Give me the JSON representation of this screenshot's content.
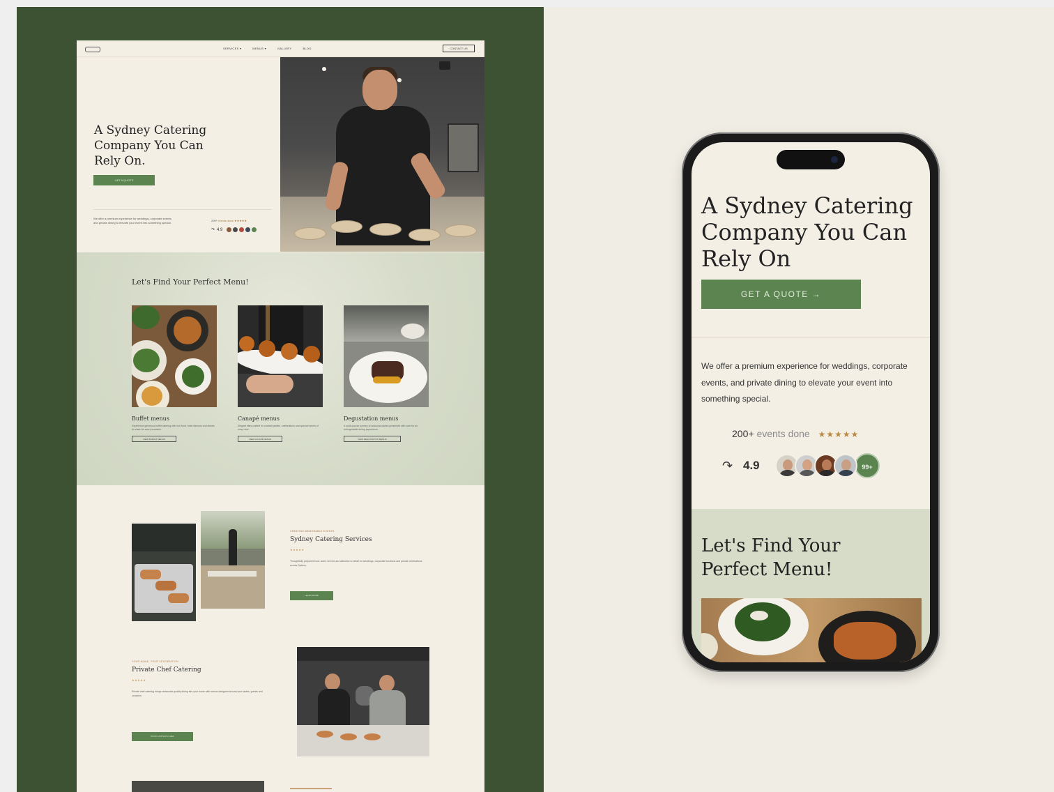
{
  "colors": {
    "brand_green": "#5b8451",
    "panel_green": "#3c5233",
    "cream": "#f3efe5",
    "sage": "#d7dcc9",
    "star_gold": "#b88a44"
  },
  "desktop": {
    "nav": {
      "links": [
        "SERVICES ▾",
        "MENUS ▾",
        "GALLERY",
        "BLOG"
      ],
      "cta": "CONTACT US"
    },
    "hero": {
      "title": "A Sydney Catering Company You Can Rely On.",
      "cta": "GET A QUOTE",
      "desc": "We offer a premium experience for weddings, corporate events, and private dining to elevate your event into something special.",
      "events": "200+",
      "events_label": "events done ★★★★★",
      "rating": "4.9"
    },
    "menus": {
      "title": "Let's Find Your Perfect Menu!",
      "cards": [
        {
          "name": "Buffet menus",
          "desc": "Experience generous buffet catering with rich food, fresh flavours and dishes to share for every occasion.",
          "btn": "VIEW BUFFET MENUS"
        },
        {
          "name": "Canapé menus",
          "desc": "Elegant bites crafted for cocktail parties, celebrations and special events of every size.",
          "btn": "VIEW CANAPÉ MENUS"
        },
        {
          "name": "Degustation menus",
          "desc": "A multi-course journey of seasonal dishes presented with care for an unforgettable dining experience.",
          "btn": "VIEW DEGUSTATION MENUS"
        }
      ]
    },
    "services": {
      "eyebrow": "CREATING MEMORABLE EVENTS",
      "title": "Sydney Catering Services",
      "stars": "★★★★★",
      "desc": "Thoughtfully prepared food, warm service and attention to detail for weddings, corporate functions and private celebrations across Sydney.",
      "btn": "LEARN MORE"
    },
    "private": {
      "eyebrow": "YOUR HOME, YOUR CELEBRATION",
      "title": "Private Chef Catering",
      "stars": "★★★★★",
      "desc": "Private chef catering brings restaurant-quality dining into your home with menus designed around your tastes, guests and occasion.",
      "btn": "BOOK A PRIVATE CHEF"
    }
  },
  "mobile": {
    "title": "A Sydney Catering Company You Can Rely On",
    "cta": "GET A QUOTE →",
    "desc": "We offer a premium experience for weddings, corporate events, and private dining to elevate your event into something special.",
    "events_count": "200+",
    "events_label": "events done",
    "stars": "★★★★★",
    "rating_arrow": "↷",
    "rating": "4.9",
    "avatars_more": "99+",
    "menu_title": "Let's Find Your Perfect Menu!"
  }
}
